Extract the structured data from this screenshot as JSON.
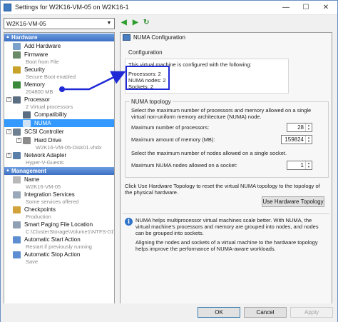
{
  "window": {
    "title": "Settings for W2K16-VM-05 on W2K16-1"
  },
  "vm_selector": {
    "value": "W2K16-VM-05"
  },
  "tree": {
    "hardware_header": "Hardware",
    "management_header": "Management",
    "hardware_items": [
      {
        "label": "Add Hardware",
        "sub": ""
      },
      {
        "label": "Firmware",
        "sub": "Boot from File"
      },
      {
        "label": "Security",
        "sub": "Secure Boot enabled"
      },
      {
        "label": "Memory",
        "sub": "204800 MB"
      },
      {
        "label": "Processor",
        "sub": "2 Virtual processors"
      },
      {
        "label": "Compatibility",
        "sub": ""
      },
      {
        "label": "NUMA",
        "sub": ""
      },
      {
        "label": "SCSI Controller",
        "sub": ""
      },
      {
        "label": "Hard Drive",
        "sub": "W2K16-VM-05-Disk01.vhdx"
      },
      {
        "label": "Network Adapter",
        "sub": "Hyper-V-Guests"
      }
    ],
    "management_items": [
      {
        "label": "Name",
        "sub": "W2K16-VM-05"
      },
      {
        "label": "Integration Services",
        "sub": "Some services offered"
      },
      {
        "label": "Checkpoints",
        "sub": "Production"
      },
      {
        "label": "Smart Paging File Location",
        "sub": "C:\\ClusterStorage\\Volume1\\NTFS-01\\W2K1..."
      },
      {
        "label": "Automatic Start Action",
        "sub": "Restart if previously running"
      },
      {
        "label": "Automatic Stop Action",
        "sub": "Save"
      }
    ]
  },
  "panel": {
    "title": "NUMA Configuration",
    "config_group": "Configuration",
    "config_intro": "This virtual machine is configured with the following:",
    "processors": "Processors: 2",
    "numa_nodes": "NUMA nodes: 2",
    "sockets": "Sockets: 2",
    "topology_group": "NUMA topology",
    "topology_desc": "Select the maximum number of processors and memory allowed on a single virtual non-uniform memory architecture (NUMA) node.",
    "max_processors_label": "Maximum number of processors:",
    "max_processors_value": "28",
    "max_memory_label": "Maximum amount of memory (MB):",
    "max_memory_value": "159824",
    "socket_desc": "Select the maximum number of nodes allowed on a single socket.",
    "max_nodes_label": "Maximum NUMA nodes allowed on a socket:",
    "max_nodes_value": "1",
    "reset_desc": "Click Use Hardware Topology to reset the virtual NUMA topology to the topology of the physical hardware.",
    "use_hw_button": "Use Hardware Topology",
    "info_1": "NUMA helps multiprocessor virtual machines scale better. With NUMA, the virtual machine's processors and memory are grouped into nodes, and nodes can be grouped into sockets.",
    "info_2": "Aligning the nodes and sockets of a virtual machine to the hardware topology helps improve the performance of NUMA-aware workloads."
  },
  "buttons": {
    "ok": "OK",
    "cancel": "Cancel",
    "apply": "Apply"
  },
  "colors": {
    "highlight": "#1f2ad6",
    "selected": "#3399ff",
    "section": "#3c6fc3"
  }
}
